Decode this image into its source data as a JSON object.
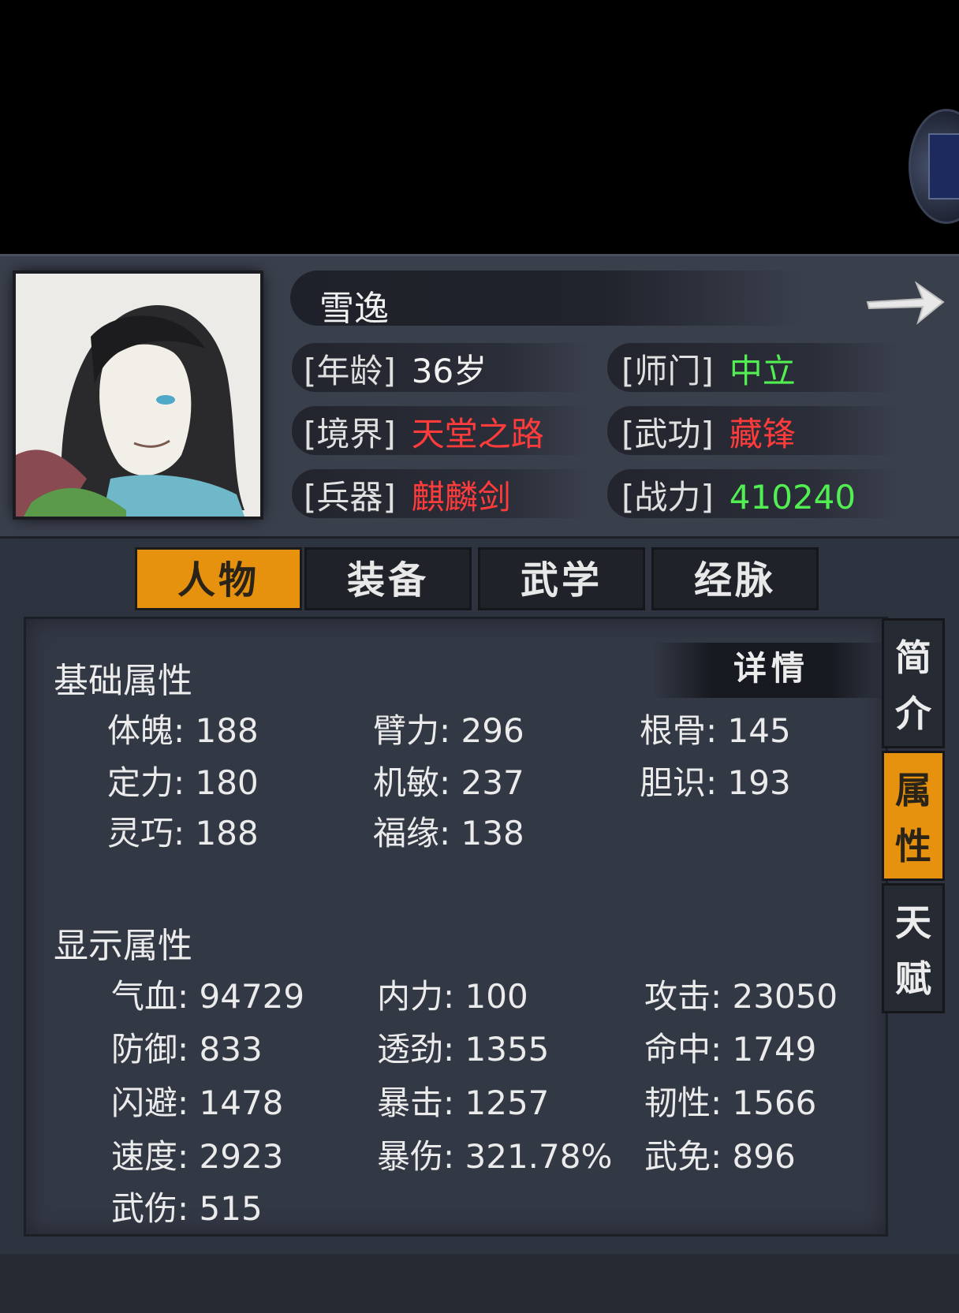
{
  "character": {
    "name": "雪逸",
    "rows": [
      {
        "label": "[年龄]",
        "value": "36岁",
        "color": "#f2f2f2"
      },
      {
        "label": "[师门]",
        "value": "中立",
        "color": "#52ef52"
      },
      {
        "label": "[境界]",
        "value": "天堂之路",
        "color": "#ff3b3b"
      },
      {
        "label": "[武功]",
        "value": "藏锋",
        "color": "#ff3b3b"
      },
      {
        "label": "[兵器]",
        "value": "麒麟剑",
        "color": "#ff3b3b"
      },
      {
        "label": "[战力]",
        "value": "410240",
        "color": "#52ef52"
      }
    ]
  },
  "tabs": [
    "人物",
    "装备",
    "武学",
    "经脉"
  ],
  "active_tab": "人物",
  "side_tabs": [
    {
      "chars": [
        "简",
        "介"
      ],
      "active": false
    },
    {
      "chars": [
        "属",
        "性"
      ],
      "active": true
    },
    {
      "chars": [
        "天",
        "赋"
      ],
      "active": false
    }
  ],
  "detail_button": "详情",
  "basic": {
    "title": "基础属性",
    "stats": [
      "体魄: 188",
      "臂力: 296",
      "根骨: 145",
      "定力: 180",
      "机敏: 237",
      "胆识: 193",
      "灵巧: 188",
      "福缘: 138"
    ]
  },
  "display": {
    "title": "显示属性",
    "stats": [
      "气血: 94729",
      "内力: 100",
      "攻击: 23050",
      "防御: 833",
      "透劲: 1355",
      "命中: 1749",
      "闪避: 1478",
      "暴击: 1257",
      "韧性: 1566",
      "速度: 2923",
      "暴伤: 321.78%",
      "武免: 896",
      "武伤: 515"
    ]
  },
  "colors": {
    "accent": "#e6920f",
    "red_value": "#ff3b3b",
    "green_value": "#52ef52"
  }
}
